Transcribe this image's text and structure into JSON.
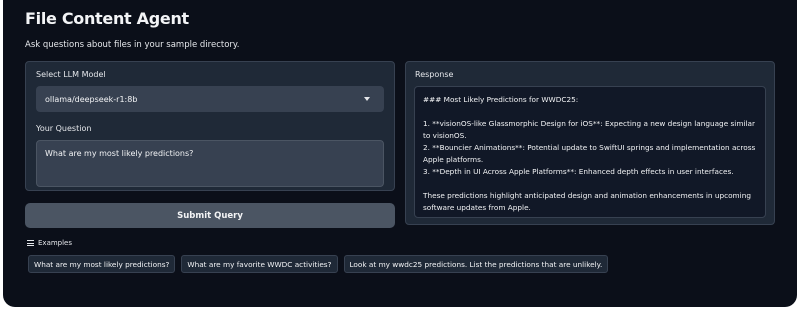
{
  "header": {
    "title": "File Content Agent",
    "subtitle": "Ask questions about files in your sample directory."
  },
  "model_select": {
    "label": "Select LLM Model",
    "value": "ollama/deepseek-r1:8b"
  },
  "question": {
    "label": "Your Question",
    "value": "What are my most likely predictions?"
  },
  "response": {
    "label": "Response",
    "lines": [
      "### Most Likely Predictions for WWDC25:",
      "",
      "1. **visionOS-like Glassmorphic Design for iOS**: Expecting a new design language similar to visionOS.",
      "2. **Bouncier Animations**: Potential update to SwiftUI springs and implementation across Apple platforms.",
      "3. **Depth in UI Across Apple Platforms**: Enhanced depth effects in user interfaces.",
      "",
      "These predictions highlight anticipated design and animation enhancements in upcoming software updates from Apple."
    ]
  },
  "submit": {
    "label": "Submit Query"
  },
  "examples": {
    "label": "Examples",
    "items": [
      "What are my most likely predictions?",
      "What are my favorite WWDC activities?",
      "Look at my wwdc25 predictions. List the predictions that are unlikely."
    ]
  }
}
